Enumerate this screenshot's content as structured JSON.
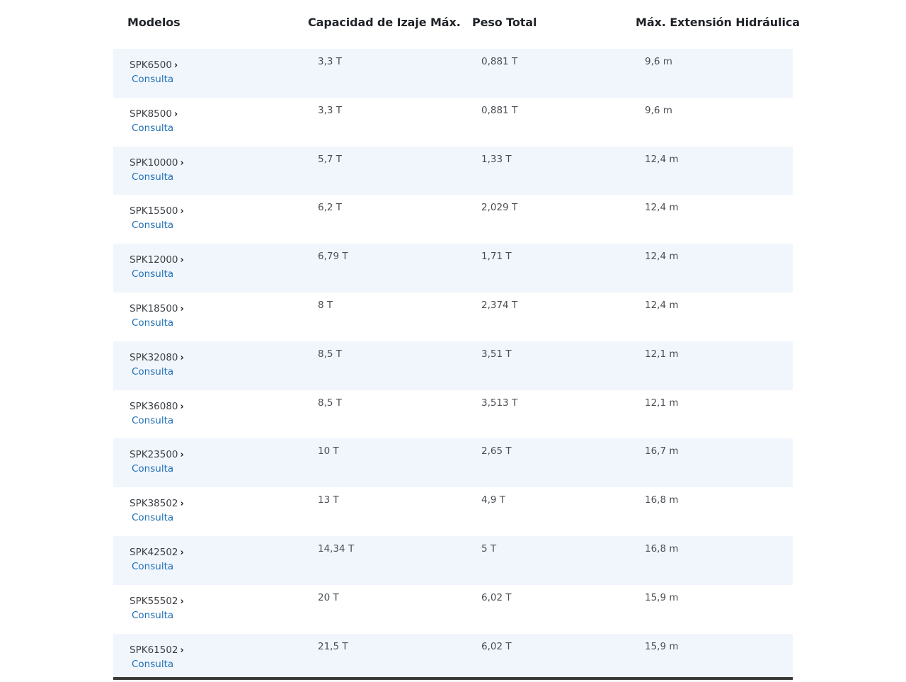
{
  "headers": {
    "model": "Modelos",
    "capacity": "Capacidad de Izaje Máx.",
    "weight": "Peso Total",
    "extension": "Máx. Extensión Hidráulica"
  },
  "consulta_label": "Consulta",
  "colors": {
    "row_alt": "#f1f6fd",
    "link_blue": "#1f6fb5",
    "header_text": "#1f2328"
  },
  "rows": [
    {
      "model": "SPK6500",
      "capacity": "3,3 T",
      "weight": "0,881 T",
      "extension": "9,6 m"
    },
    {
      "model": "SPK8500",
      "capacity": "3,3 T",
      "weight": "0,881 T",
      "extension": "9,6 m"
    },
    {
      "model": "SPK10000",
      "capacity": "5,7 T",
      "weight": "1,33 T",
      "extension": "12,4 m"
    },
    {
      "model": "SPK15500",
      "capacity": "6,2 T",
      "weight": "2,029 T",
      "extension": "12,4 m"
    },
    {
      "model": "SPK12000",
      "capacity": "6,79 T",
      "weight": "1,71 T",
      "extension": "12,4 m"
    },
    {
      "model": "SPK18500",
      "capacity": "8 T",
      "weight": "2,374 T",
      "extension": "12,4 m"
    },
    {
      "model": "SPK32080",
      "capacity": "8,5 T",
      "weight": "3,51 T",
      "extension": "12,1 m"
    },
    {
      "model": "SPK36080",
      "capacity": "8,5 T",
      "weight": "3,513 T",
      "extension": "12,1 m"
    },
    {
      "model": "SPK23500",
      "capacity": "10 T",
      "weight": "2,65 T",
      "extension": "16,7 m"
    },
    {
      "model": "SPK38502",
      "capacity": "13 T",
      "weight": "4,9 T",
      "extension": "16,8 m"
    },
    {
      "model": "SPK42502",
      "capacity": "14,34 T",
      "weight": "5 T",
      "extension": "16,8 m"
    },
    {
      "model": "SPK55502",
      "capacity": "20 T",
      "weight": "6,02 T",
      "extension": "15,9 m"
    },
    {
      "model": "SPK61502",
      "capacity": "21,5 T",
      "weight": "6,02 T",
      "extension": "15,9 m"
    }
  ]
}
